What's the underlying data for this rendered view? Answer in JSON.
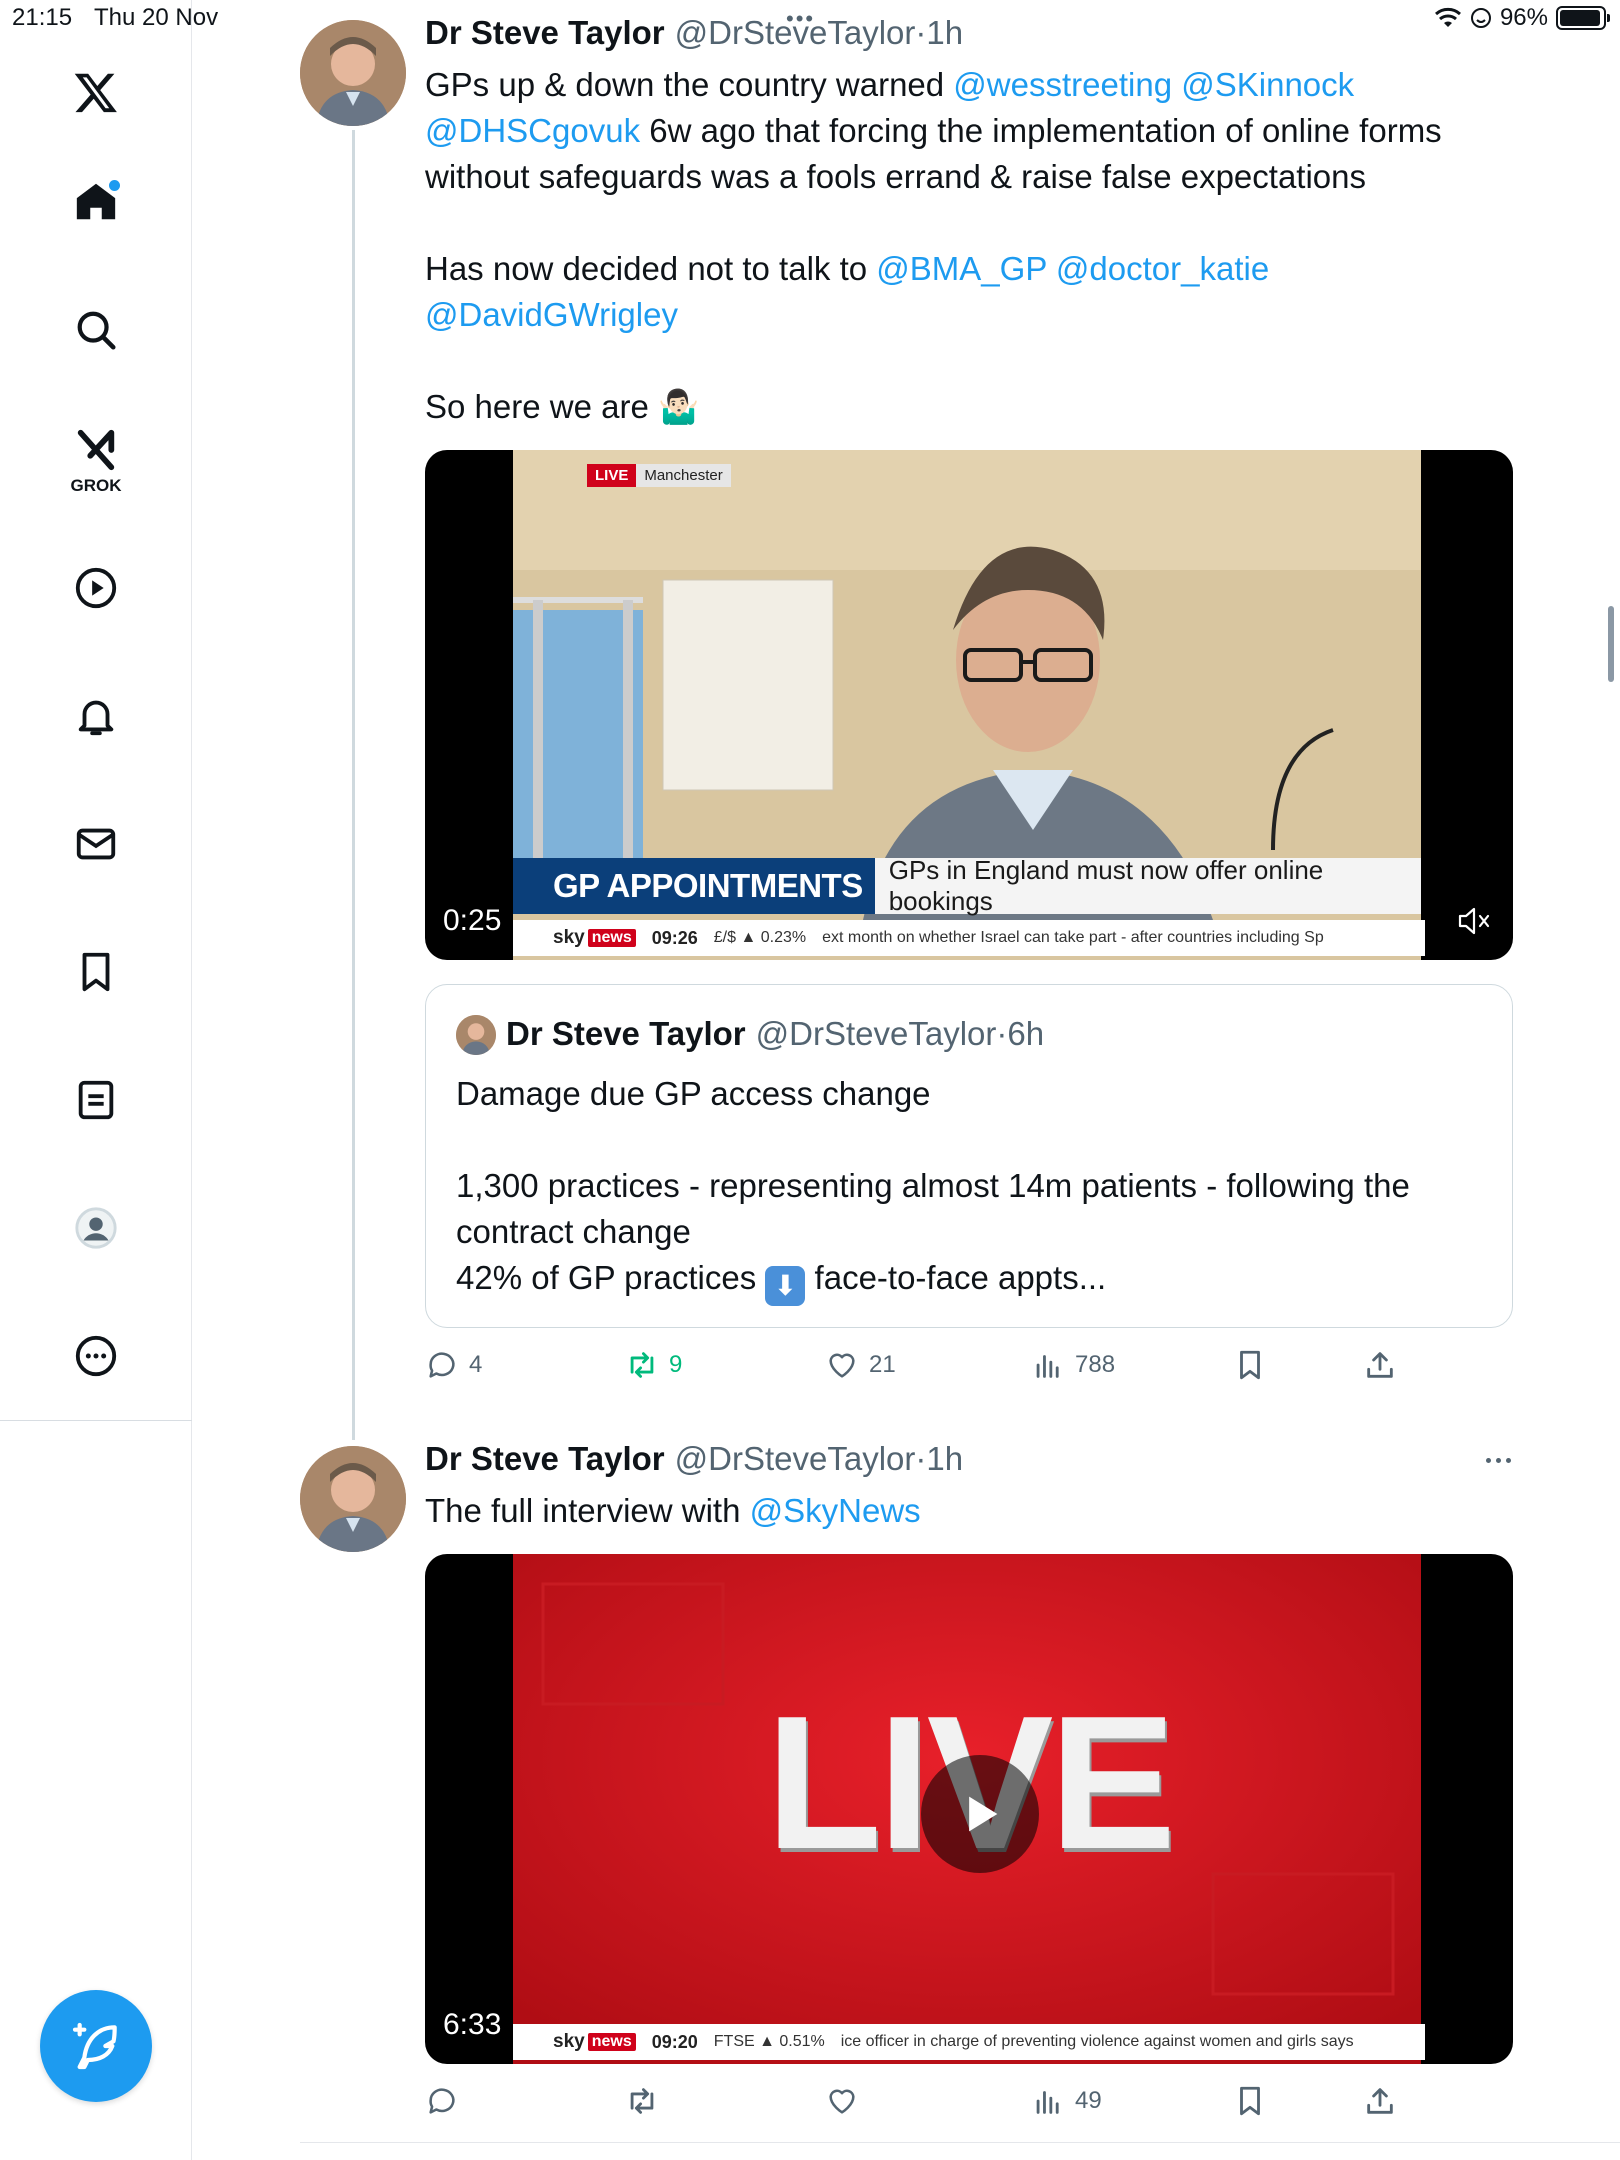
{
  "status_bar": {
    "time": "21:15",
    "date": "Thu 20 Nov",
    "battery": "96%",
    "battery_level": 0.96
  },
  "sidebar": {
    "items": [
      {
        "name": "x-logo-icon"
      },
      {
        "name": "home-icon",
        "active": true
      },
      {
        "name": "search-icon"
      },
      {
        "name": "grok-icon",
        "label": "GROK"
      },
      {
        "name": "video-icon"
      },
      {
        "name": "notifications-icon"
      },
      {
        "name": "messages-icon"
      },
      {
        "name": "bookmarks-icon"
      },
      {
        "name": "lists-icon"
      },
      {
        "name": "profile-icon"
      },
      {
        "name": "more-icon"
      }
    ],
    "compose_icon": "compose-feather-icon"
  },
  "tweets": [
    {
      "name": "Dr Steve Taylor",
      "handle": "@DrSteveTaylor",
      "time": "1h",
      "text_lines": {
        "l1_pre": "GPs up & down the country warned ",
        "l1_m1": "@wesstreeting",
        "l1_m2": "@SKinnock",
        "l2_m1": "@DHSCgovuk",
        "l2_post": " 6w ago that forcing the implementation of online forms",
        "l3": "without safeguards was a fools errand & raise false expectations",
        "l4_pre": "Has now decided not to talk to ",
        "l4_m1": "@BMA_GP",
        "l4_m2": "@doctor_katie",
        "l5_m1": "@DavidGWrigley",
        "l6": "So here we are 🤷🏻‍♂️"
      },
      "video": {
        "duration": "0:25",
        "live_tag": "LIVE",
        "location": "Manchester",
        "headline_left": "GP APPOINTMENTS",
        "headline_right": "GPs in England must now offer online bookings",
        "ticker_logo_sky": "sky",
        "ticker_logo_news": "news",
        "ticker_time": "09:26",
        "ticker_market": "£/$ ▲ 0.23%",
        "ticker_text": "ext month on whether Israel can take part - after countries including Sp"
      },
      "quote": {
        "name": "Dr Steve Taylor",
        "handle": "@DrSteveTaylor",
        "time": "6h",
        "line1": "Damage due GP access change",
        "line2": "1,300 practices - representing almost 14m patients - following the",
        "line3": "contract change",
        "line4_pre": "42% of GP practices ",
        "line4_emoji": "⬇",
        "line4_post": " face-to-face appts..."
      },
      "actions": {
        "replies": "4",
        "reposts": "9",
        "likes": "21",
        "views": "788"
      }
    },
    {
      "name": "Dr Steve Taylor",
      "handle": "@DrSteveTaylor",
      "time": "1h",
      "text_pre": "The full interview with ",
      "text_mention": "@SkyNews",
      "video": {
        "duration": "6:33",
        "big_text": "LIVE",
        "ticker_logo_sky": "sky",
        "ticker_logo_news": "news",
        "ticker_time": "09:20",
        "ticker_market": "FTSE ▲ 0.51%",
        "ticker_text": "ice officer in charge of preventing violence against women and girls says"
      },
      "actions": {
        "replies": "",
        "reposts": "",
        "likes": "",
        "views": "49"
      }
    }
  ],
  "dot_separator": "·",
  "colors": {
    "accent": "#1d9bf0",
    "repost_active": "#00ba7c",
    "secondary_text": "#536471"
  }
}
